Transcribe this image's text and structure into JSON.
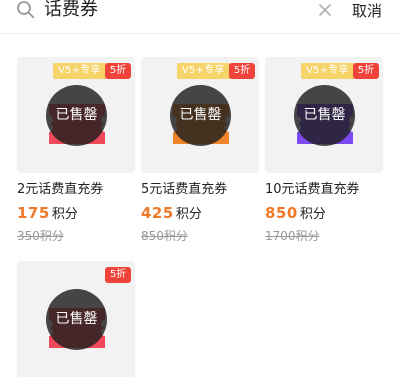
{
  "search": {
    "value": "话费券",
    "clear_icon": "close-icon",
    "cancel_label": "取消"
  },
  "sold_out_label": "已售罄",
  "products": [
    {
      "vip_tag": "V5+专享",
      "discount": "5折",
      "title": "2元话费直充券",
      "price": "175",
      "price_unit": "积分",
      "original": "350积分",
      "ticket_color": "#f04a5a"
    },
    {
      "vip_tag": "V5+专享",
      "discount": "5折",
      "title": "5元话费直充券",
      "price": "425",
      "price_unit": "积分",
      "original": "850积分",
      "ticket_color": "#f0842b"
    },
    {
      "vip_tag": "V5+专享",
      "discount": "5折",
      "title": "10元话费直充券",
      "price": "850",
      "price_unit": "积分",
      "original": "1700积分",
      "ticket_color": "#7b4af0"
    },
    {
      "discount": "5折",
      "ticket_color": "#f04a5a"
    }
  ]
}
